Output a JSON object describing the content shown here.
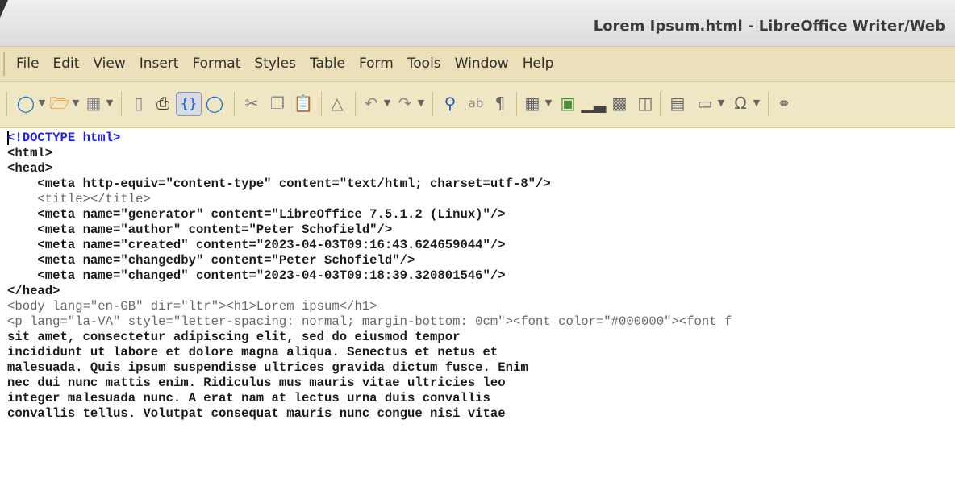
{
  "window": {
    "title": "Lorem Ipsum.html - LibreOffice Writer/Web"
  },
  "menu": [
    "File",
    "Edit",
    "View",
    "Insert",
    "Format",
    "Styles",
    "Table",
    "Form",
    "Tools",
    "Window",
    "Help"
  ],
  "colors": {
    "menubar": "#ebe0b9",
    "toolbar": "#efe6c4",
    "doctype": "#2020ee",
    "tag_text": "#1b1b1b",
    "dim_text": "#666666"
  },
  "toolbar": {
    "icons": [
      "globe-icon",
      "folder-open-icon",
      "save-icon",
      "export-pdf-icon",
      "print-icon",
      "html-source-icon",
      "web-view-icon",
      "cut-icon",
      "copy-icon",
      "paste-icon",
      "clone-format-icon",
      "undo-icon",
      "redo-icon",
      "find-replace-icon",
      "spelling-icon",
      "formatting-marks-icon",
      "table-icon",
      "image-icon",
      "chart-icon",
      "textbox-icon",
      "page-break-icon",
      "field-icon",
      "special-character-icon",
      "hyperlink-icon"
    ]
  },
  "source": [
    "<!DOCTYPE html>",
    "<html>",
    "<head>",
    "    <meta http-equiv=\"content-type\" content=\"text/html; charset=utf-8\"/>",
    "    <title></title>",
    "    <meta name=\"generator\" content=\"LibreOffice 7.5.1.2 (Linux)\"/>",
    "    <meta name=\"author\" content=\"Peter Schofield\"/>",
    "    <meta name=\"created\" content=\"2023-04-03T09:16:43.624659044\"/>",
    "    <meta name=\"changedby\" content=\"Peter Schofield\"/>",
    "    <meta name=\"changed\" content=\"2023-04-03T09:18:39.320801546\"/>",
    "</head>",
    "<body lang=\"en-GB\" dir=\"ltr\"><h1>Lorem ipsum</h1>",
    "<p lang=\"la-VA\" style=\"letter-spacing: normal; margin-bottom: 0cm\"><font color=\"#000000\"><font f",
    "sit amet, consectetur adipiscing elit, sed do eiusmod tempor",
    "incididunt ut labore et dolore magna aliqua. Senectus et netus et",
    "malesuada. Quis ipsum suspendisse ultrices gravida dictum fusce. Enim",
    "nec dui nunc mattis enim. Ridiculus mus mauris vitae ultricies leo",
    "integer malesuada nunc. A erat nam at lectus urna duis convallis",
    "convallis tellus. Volutpat consequat mauris nunc congue nisi vitae"
  ]
}
